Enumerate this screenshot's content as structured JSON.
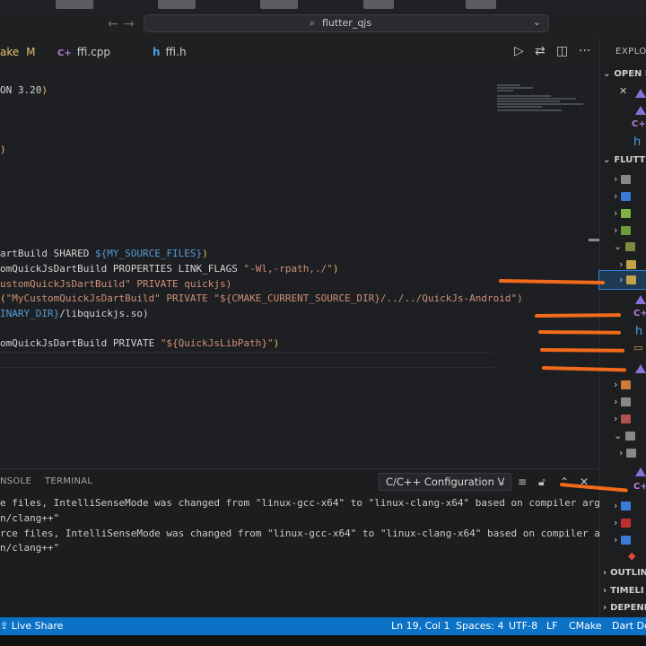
{
  "titlebar": {
    "search_text": "flutter_qjs"
  },
  "tabs": [
    {
      "lang": "",
      "label": "ake",
      "badge": "M"
    },
    {
      "lang": "C+",
      "label": "ffi.cpp"
    },
    {
      "lang": "h",
      "label": "ffi.h"
    }
  ],
  "editor": {
    "lines": [
      {
        "parts": [
          [
            "kw",
            "ON 3.20"
          ],
          [
            "paren",
            ")"
          ]
        ]
      },
      {
        "parts": [
          [
            "paren",
            ")"
          ]
        ]
      },
      {
        "parts": [
          [
            "kw",
            "artBuild SHARED "
          ],
          [
            "var",
            "${MY_SOURCE_FILES}"
          ],
          [
            "paren",
            ")"
          ]
        ]
      },
      {
        "parts": [
          [
            "kw",
            "omQuickJsDartBuild PROPERTIES LINK_FLAGS "
          ],
          [
            "str",
            "\"-Wl,-rpath,./\""
          ],
          [
            "paren",
            ")"
          ]
        ]
      },
      {
        "parts": [
          [
            "str",
            "ustomQuickJsDartBuild\" PRIVATE quickjs)"
          ]
        ]
      },
      {
        "parts": [
          [
            "paren",
            "("
          ],
          [
            "str",
            "\"MyCustomQuickJsDartBuild\" PRIVATE \"${CMAKE_CURRENT_SOURCE_DIR}/../../QuickJs-Android\")"
          ]
        ]
      },
      {
        "parts": [
          [
            "var",
            "INARY_DIR}"
          ],
          [
            "kw",
            "/libquickjs.so)"
          ]
        ]
      },
      {
        "parts": [
          [
            "kw",
            "omQuickJsDartBuild PRIVATE "
          ],
          [
            "str",
            "\"${QuickJsLibPath}\""
          ],
          [
            "paren",
            ")"
          ]
        ]
      }
    ]
  },
  "panel": {
    "tabs": [
      "NSOLE",
      "TERMINAL"
    ],
    "select_value": "C/C++ Configuration V",
    "output": [
      "e files, IntelliSenseMode was changed from \"linux-gcc-x64\" to \"linux-clang-x64\" based on compiler args",
      "n/clang++\"",
      "rce files, IntelliSenseMode was changed from \"linux-gcc-x64\" to \"linux-clang-x64\" based on compiler args",
      "n/clang++\""
    ]
  },
  "explorer": {
    "title": "EXPLOR",
    "open_editors": "OPEN E",
    "project": "FLUTTE",
    "outline": "OUTLIN",
    "timeline": "TIMELI",
    "dependencies": "DEPENE"
  },
  "statusbar": {
    "live_share": "Live Share",
    "position": "Ln 19, Col 1",
    "spaces": "Spaces: 4",
    "encoding": "UTF-8",
    "eol": "LF",
    "language": "CMake",
    "extra": "Dart De"
  },
  "colors": {
    "accent": "#0b72c6",
    "annotation": "#f26a1b"
  }
}
